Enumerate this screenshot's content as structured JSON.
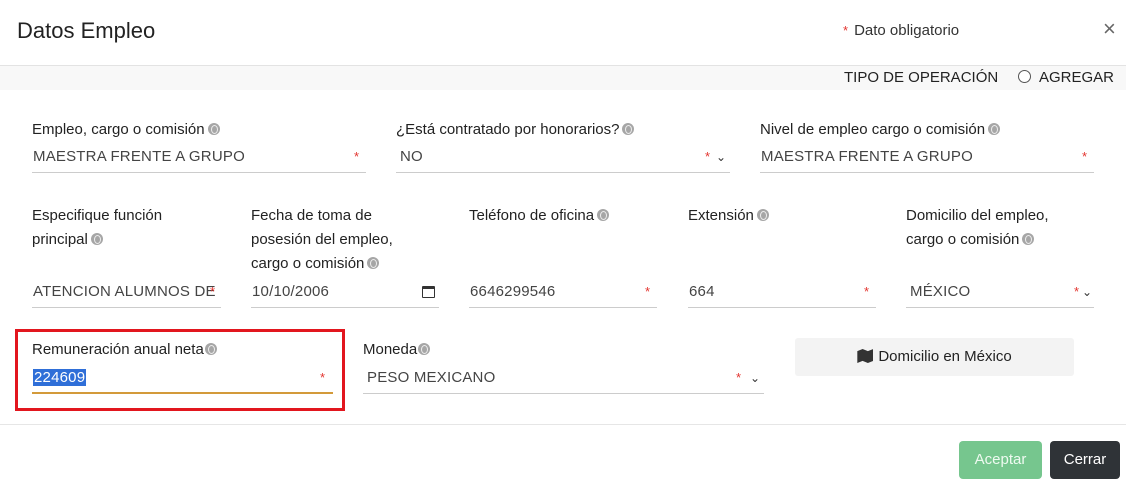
{
  "modal": {
    "title": "Datos Empleo",
    "required_star": "*",
    "required_note": "Dato obligatorio",
    "close_symbol": "×"
  },
  "operation": {
    "label": "TIPO DE OPERACIÓN",
    "option": "AGREGAR"
  },
  "fields": {
    "empleo": {
      "label": "Empleo, cargo o comisión",
      "value": "MAESTRA FRENTE A GRUPO"
    },
    "honorarios": {
      "label": "¿Está contratado por honorarios?",
      "value": "NO"
    },
    "nivel": {
      "label": "Nivel de empleo cargo o comisión",
      "value": "MAESTRA FRENTE A GRUPO"
    },
    "funcion": {
      "label_line1": "Especifique función",
      "label_line2": "principal",
      "value": "ATENCION ALUMNOS DE"
    },
    "fecha": {
      "label_line1": "Fecha de toma de",
      "label_line2": "posesión del empleo,",
      "label_line3": "cargo o comisión",
      "value": "10/10/2006"
    },
    "telefono": {
      "label": "Teléfono de oficina",
      "value": "6646299546"
    },
    "extension": {
      "label": "Extensión",
      "value": "664"
    },
    "domicilio": {
      "label_line1": "Domicilio del empleo,",
      "label_line2": "cargo o comisión",
      "value": "MÉXICO"
    },
    "remuneracion": {
      "label": "Remuneración anual neta",
      "value": "224609"
    },
    "moneda": {
      "label": "Moneda",
      "value": "PESO MEXICANO"
    }
  },
  "buttons": {
    "domicilio_mexico": "Domicilio en México",
    "aceptar": "Aceptar",
    "cerrar": "Cerrar"
  },
  "icons": {
    "info": "globe-icon",
    "dropdown": "chevron-down-icon",
    "calendar": "calendar-icon",
    "map": "map-marker-icon"
  },
  "colors": {
    "required": "#e3342f",
    "highlight_border": "#e2161e",
    "accept_button": "#76c68e",
    "close_button": "#2f3337",
    "active_underline": "#d39a3a"
  }
}
